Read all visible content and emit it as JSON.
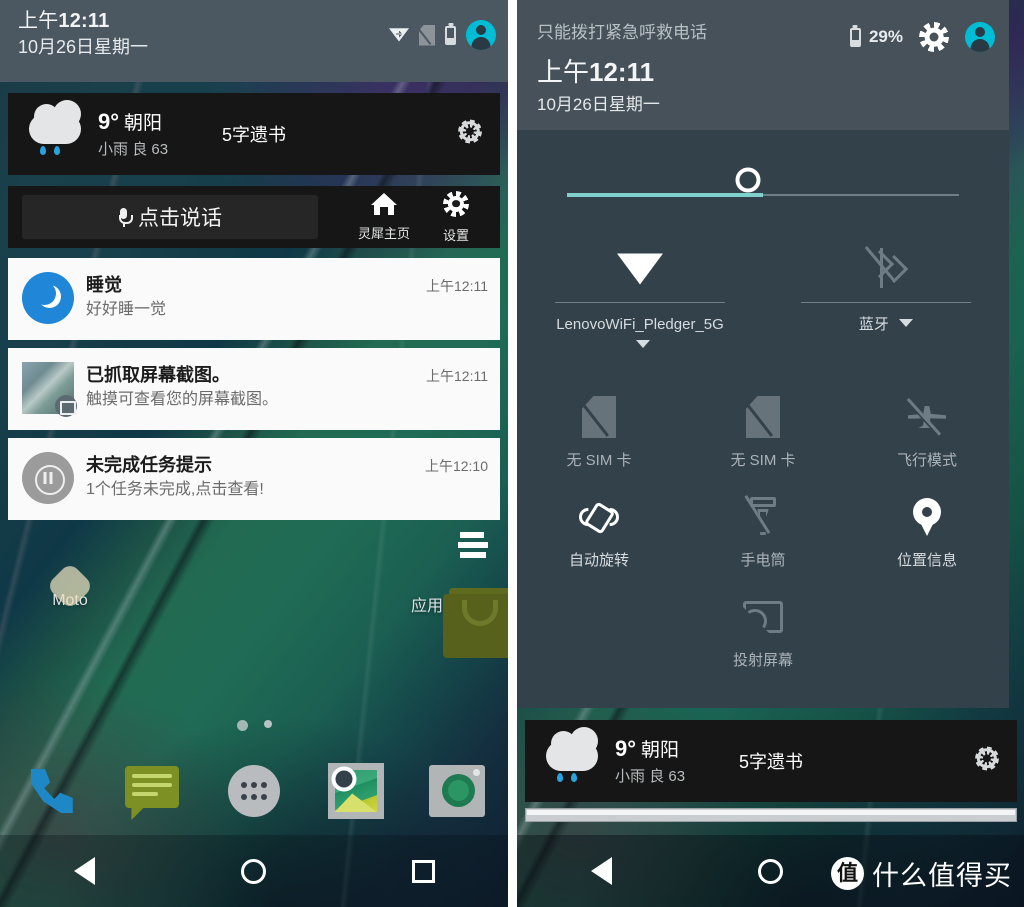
{
  "left_phone": {
    "status_bar": {
      "time": "上午12:11",
      "time_prefix": "上午",
      "time_value": "12:11",
      "date": "10月26日星期一",
      "icons": [
        "wifi-arrows-icon",
        "no-sim-icon",
        "battery-icon",
        "user-avatar-icon"
      ]
    },
    "weather_widget": {
      "temperature": "9°",
      "city": "朝阳",
      "condition": "小雨",
      "air_quality_label": "良",
      "air_quality_value": "63",
      "headline": "5字遗书",
      "settings_icon": "gear-icon"
    },
    "voice_bar": {
      "mic_icon": "microphone-icon",
      "prompt": "点击说话",
      "actions": [
        {
          "icon": "home-icon",
          "label": "灵犀主页"
        },
        {
          "icon": "gear-icon",
          "label": "设置"
        }
      ]
    },
    "notifications": [
      {
        "icon": "moon-icon",
        "title": "睡觉",
        "text": "好好睡一觉",
        "time": "上午12:11"
      },
      {
        "icon": "screenshot-thumbnail-icon",
        "title": "已抓取屏幕截图。",
        "text": "触摸可查看您的屏幕截图。",
        "time": "上午12:11"
      },
      {
        "icon": "pause-icon",
        "title": "未完成任务提示",
        "text": "1个任务未完成,点击查看!",
        "time": "上午12:10"
      }
    ],
    "home_screen": {
      "apps": [
        {
          "icon": "moto-icon",
          "label": "Moto"
        },
        {
          "icon": "app-store-bag-icon",
          "label": "应用中心"
        }
      ],
      "page_dots": 2,
      "active_dot": 0,
      "dock": [
        {
          "icon": "phone-icon"
        },
        {
          "icon": "messages-icon"
        },
        {
          "icon": "all-apps-icon"
        },
        {
          "icon": "gallery-icon"
        },
        {
          "icon": "camera-icon"
        }
      ]
    },
    "nav_bar": [
      "back-icon",
      "home-icon",
      "recents-icon"
    ]
  },
  "right_phone": {
    "status_bar": {
      "carrier": "只能拨打紧急呼救电话",
      "battery_percent": "29%",
      "icons": [
        "battery-icon",
        "gear-icon",
        "user-avatar-icon"
      ],
      "time": "上午12:11",
      "time_prefix": "上午",
      "time_value": "12:11",
      "date": "10月26日星期一"
    },
    "quick_settings": {
      "brightness": {
        "icon": "brightness-sun-icon",
        "value_percent": 50
      },
      "dual_tiles": [
        {
          "icon": "wifi-icon",
          "label": "LenovoWiFi_Pledger_5G",
          "state": "on",
          "has_caret": true
        },
        {
          "icon": "bluetooth-off-icon",
          "label": "蓝牙",
          "state": "off",
          "has_caret": true
        }
      ],
      "tiles": [
        {
          "icon": "no-sim-icon",
          "label": "无 SIM 卡",
          "state": "off"
        },
        {
          "icon": "no-sim-icon",
          "label": "无 SIM 卡",
          "state": "off"
        },
        {
          "icon": "airplane-mode-icon",
          "label": "飞行模式",
          "state": "off"
        },
        {
          "icon": "auto-rotate-icon",
          "label": "自动旋转",
          "state": "on"
        },
        {
          "icon": "flashlight-off-icon",
          "label": "手电筒",
          "state": "off"
        },
        {
          "icon": "location-icon",
          "label": "位置信息",
          "state": "on"
        },
        {
          "icon": "cast-screen-icon",
          "label": "投射屏幕",
          "state": "off"
        }
      ]
    },
    "weather_widget": {
      "temperature": "9°",
      "city": "朝阳",
      "condition": "小雨",
      "air_quality_label": "良",
      "air_quality_value": "63",
      "headline": "5字遗书",
      "settings_icon": "gear-icon"
    },
    "nav_bar": [
      "back-icon",
      "home-icon"
    ],
    "watermark": {
      "logo_glyph": "值",
      "text": "什么值得买"
    }
  },
  "colors": {
    "accent_cyan": "#00bcd4",
    "status_header": "#4b5861",
    "qs_header": "#465159",
    "qs_panel": "#33414a",
    "widget_bg": "#161616",
    "notification_bg": "#fafafa",
    "brightness_fill": "#7fd1cb",
    "tile_off": "#6d7c85",
    "tile_on": "#ffffff"
  }
}
